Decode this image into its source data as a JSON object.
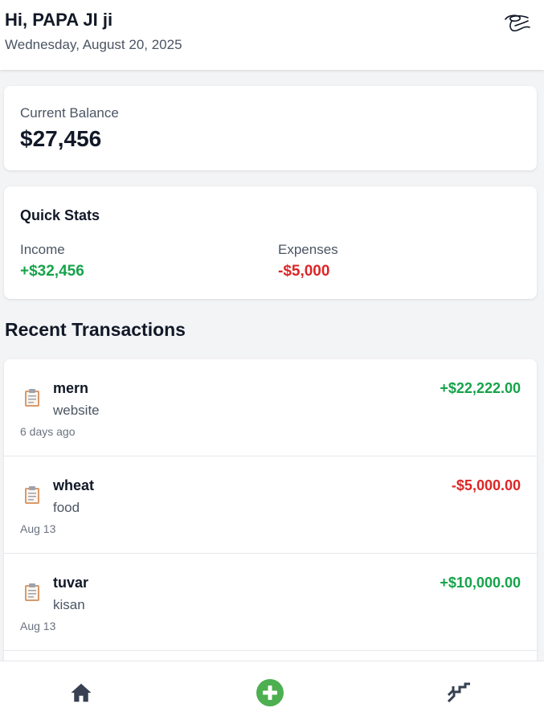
{
  "header": {
    "greeting": "Hi, PAPA JI ji",
    "date": "Wednesday, August 20, 2025",
    "avatar_icon": "signature-avatar-icon"
  },
  "balance": {
    "label": "Current Balance",
    "value": "$27,456"
  },
  "stats": {
    "title": "Quick Stats",
    "income_label": "Income",
    "income_value": "+$32,456",
    "expenses_label": "Expenses",
    "expenses_value": "-$5,000"
  },
  "transactions": {
    "title": "Recent Transactions",
    "items": [
      {
        "name": "mern",
        "category": "website",
        "date": "6 days ago",
        "amount": "+$22,222.00",
        "type": "income"
      },
      {
        "name": "wheat",
        "category": "food",
        "date": "Aug 13",
        "amount": "-$5,000.00",
        "type": "expense"
      },
      {
        "name": "tuvar",
        "category": "kisan",
        "date": "Aug 13",
        "amount": "+$10,000.00",
        "type": "income"
      }
    ]
  },
  "nav": {
    "home_icon": "home-icon",
    "add_icon": "add-icon",
    "stats_icon": "stats-icon"
  },
  "colors": {
    "income": "#16a34a",
    "expense": "#dc2626",
    "accent": "#4caf50"
  }
}
